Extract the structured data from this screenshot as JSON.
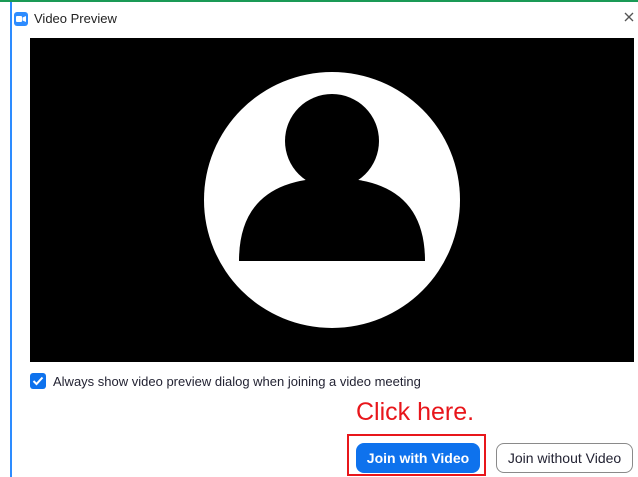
{
  "window": {
    "title": "Video Preview",
    "close_symbol": "✕",
    "app_icon": "zoom-camera-icon"
  },
  "preview": {
    "placeholder_icon": "user-avatar-icon",
    "background_color": "#000000"
  },
  "options": {
    "always_show_label": "Always show video preview dialog when joining a video meeting",
    "always_show_checked": true
  },
  "annotation": {
    "text": "Click here.",
    "color": "#e8161b"
  },
  "actions": {
    "join_with_video": "Join with Video",
    "join_without_video": "Join without Video"
  },
  "colors": {
    "accent": "#0e72ed",
    "top_accent": "#1a9a56"
  }
}
